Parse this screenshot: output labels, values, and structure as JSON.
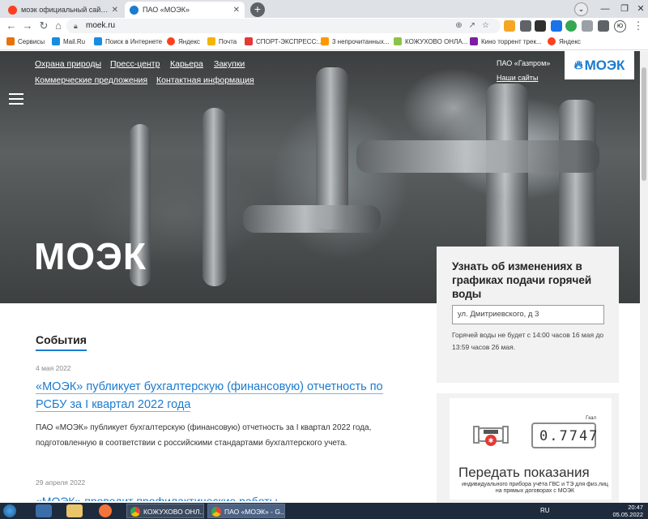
{
  "browser": {
    "tabs": [
      {
        "title": "моэк официальный сайт — Янд",
        "favicon_color": "#fc3f1d",
        "active": false
      },
      {
        "title": "ПАО «МОЭК»",
        "favicon_color": "#1b7bcf",
        "active": true
      }
    ],
    "new_tab": "+",
    "url": "moek.ru",
    "bookmarks": [
      {
        "label": "Сервисы",
        "color": "#e8710a"
      },
      {
        "label": "Mail.Ru",
        "color": "#168de2"
      },
      {
        "label": "Поиск в Интернете",
        "color": "#168de2"
      },
      {
        "label": "Яндекс",
        "color": "#fc3f1d"
      },
      {
        "label": "Почта",
        "color": "#f5b400"
      },
      {
        "label": "СПОРТ-ЭКСПРЕСС:...",
        "color": "#e53935"
      },
      {
        "label": "3 непрочитанных...",
        "color": "#ff9800"
      },
      {
        "label": "КОЖУХОВО ОНЛА...",
        "color": "#8bc34a"
      },
      {
        "label": "Кино торрент трек...",
        "color": "#7b1fa2"
      },
      {
        "label": "Яндекс",
        "color": "#fc3f1d"
      }
    ],
    "profile_initials": "Ю"
  },
  "site": {
    "nav": {
      "row1": [
        "Охрана природы",
        "Пресс-центр",
        "Карьера",
        "Закупки"
      ],
      "row2": [
        "Коммерческие предложения",
        "Контактная информация"
      ],
      "gazprom": "ПАО «Газпром»",
      "our_sites": "Наши сайты"
    },
    "logo": "МОЭК",
    "hero_title": "МОЭК",
    "schedule_panel": {
      "title": "Узнать об изменениях в графиках подачи горячей воды",
      "address_value": "ул. Дмитриевского, д 3",
      "note": "Горячей воды не будет с 14:00 часов 16 мая до 13:59 часов 26 мая."
    },
    "meter_panel": {
      "digits": "0.7747",
      "unit": "Гкал",
      "title": "Передать показания",
      "subtitle": "индивидуального прибора учёта ГВС и ТЭ для физ.лиц на прямых договорах с МОЭК"
    },
    "events": {
      "heading": "События",
      "items": [
        {
          "date": "4 мая 2022",
          "title": "«МОЭК» публикует бухгалтерскую (финансовую) отчетность по РСБУ за I квартал 2022 года",
          "text": "ПАО «МОЭК» публикует бухгалтерскую (финансовую) отчетность за I квартал 2022 года, подготовленную в соответствии с российскими стандартами бухгалтерского учета."
        },
        {
          "date": "29 апреля 2022",
          "title": "«МОЭК» проводит профилактические работы"
        }
      ]
    }
  },
  "taskbar": {
    "items": [
      {
        "label": "КОЖУХОВО ОНЛ..."
      },
      {
        "label": "ПАО «МОЭК» - G..."
      }
    ],
    "lang": "RU",
    "time": "20:47",
    "date": "05.05.2022"
  }
}
